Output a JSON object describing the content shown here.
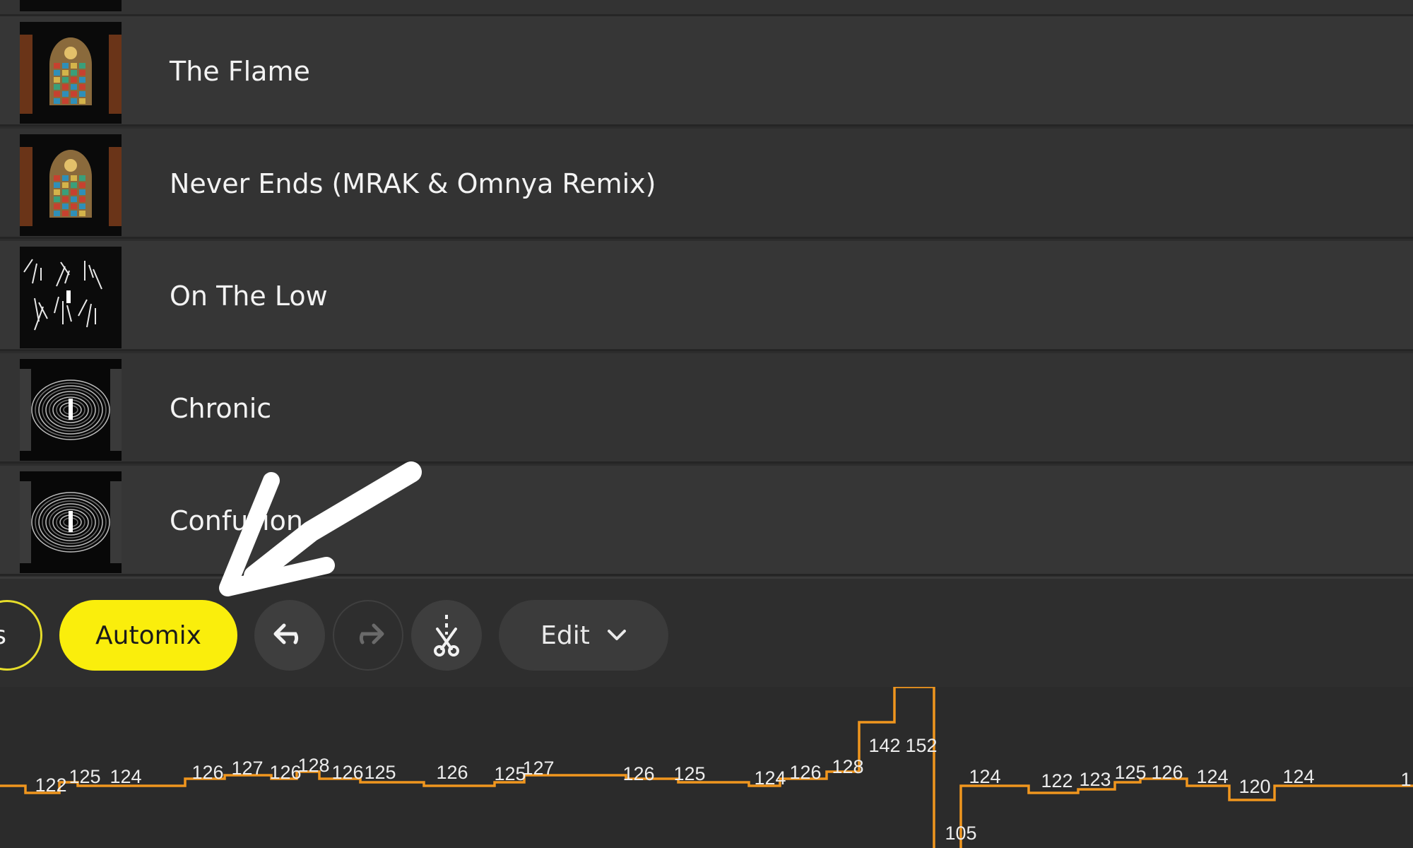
{
  "tracks": [
    {
      "title": "The Flame",
      "art": "stained-glass-window"
    },
    {
      "title": "Never Ends (MRAK & Omnya Remix)",
      "art": "stained-glass-window"
    },
    {
      "title": "On The Low",
      "art": "dark-graphic"
    },
    {
      "title": "Chronic",
      "art": "symmetric-pattern"
    },
    {
      "title": "Confusion",
      "art": "symmetric-pattern"
    }
  ],
  "toolbar": {
    "prev_label": "s",
    "automix_label": "Automix",
    "edit_label": "Edit",
    "undo_icon": "undo-icon",
    "redo_icon": "redo-icon",
    "cut_icon": "scissors-cut-icon",
    "edit_chevron_icon": "chevron-down-icon"
  },
  "colors": {
    "automix": "#faee0c",
    "bpm_line": "#f0961e",
    "arrow": "#ffffff"
  },
  "bpm_labels": [
    "122",
    "125",
    "124",
    "126",
    "127",
    "126",
    "128",
    "126",
    "125",
    "126",
    "125",
    "127",
    "126",
    "125",
    "124",
    "126",
    "128",
    "142",
    "152",
    "105",
    "124",
    "122",
    "123",
    "125",
    "126",
    "124",
    "120",
    "124",
    "1"
  ]
}
